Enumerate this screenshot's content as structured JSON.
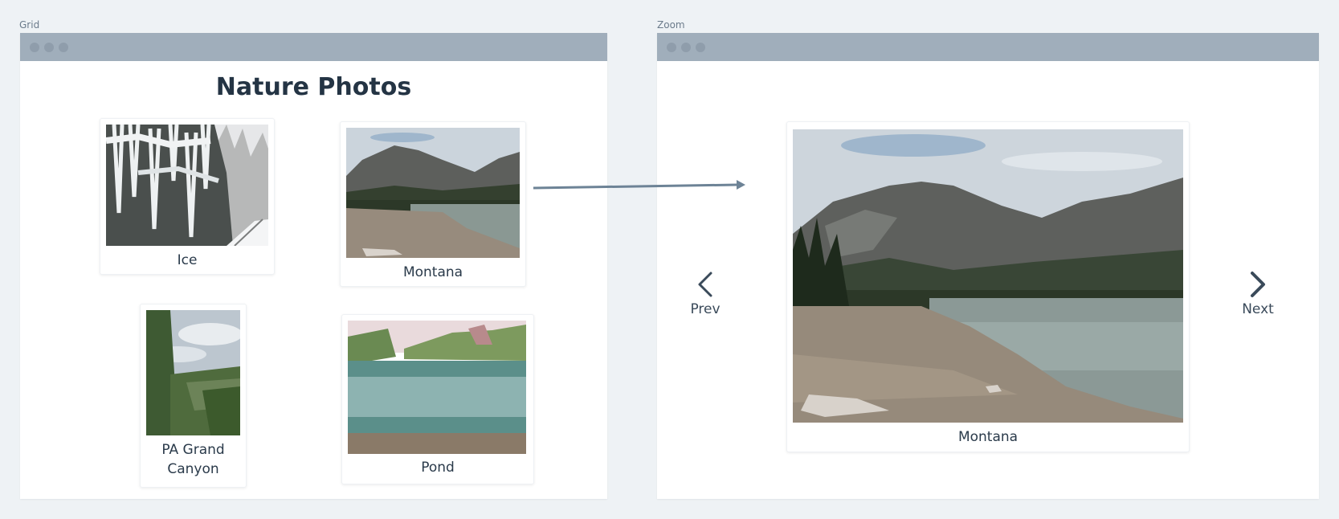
{
  "panels": {
    "grid_label": "Grid",
    "zoom_label": "Zoom"
  },
  "grid": {
    "title": "Nature Photos",
    "items": [
      {
        "caption": "Ice",
        "photo": "icicles-cliff-photo"
      },
      {
        "caption": "Montana",
        "photo": "mountain-lake-photo"
      },
      {
        "caption": "PA Grand Canyon",
        "photo": "forest-canyon-photo"
      },
      {
        "caption": "Pond",
        "photo": "green-pond-photo"
      }
    ]
  },
  "zoom": {
    "caption": "Montana",
    "prev_label": "Prev",
    "next_label": "Next",
    "photo": "mountain-lake-photo"
  },
  "colors": {
    "background": "#eef2f5",
    "titlebar": "#a0aebb",
    "arrow": "#6d8396",
    "text": "#243444"
  }
}
